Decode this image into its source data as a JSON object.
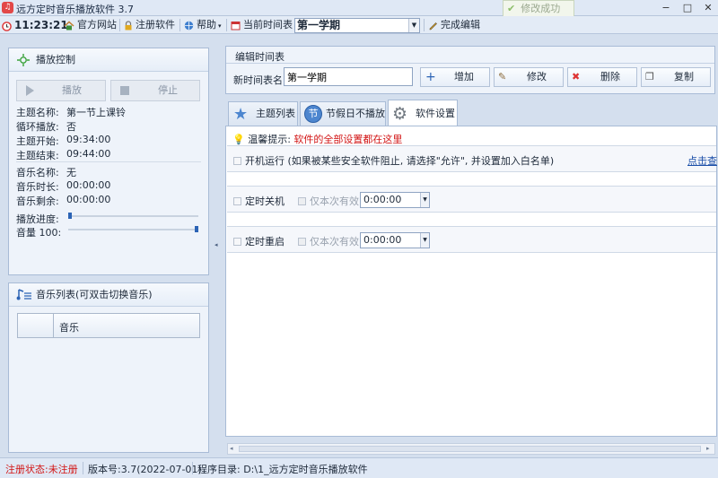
{
  "title": {
    "text": "远方定时音乐播放软件 3.7",
    "icon": "music-note-icon"
  },
  "window_controls": {
    "minimize": "−",
    "maximize": "□",
    "close": "✕"
  },
  "toast": {
    "text": "修改成功",
    "icon": "check-icon"
  },
  "toolbar": {
    "clock": "11:23:21",
    "official_site": "官方网站",
    "register": "注册软件",
    "help": "帮助",
    "current_timetable_label": "当前时间表",
    "current_timetable_value": "第一学期",
    "finish_edit": "完成编辑"
  },
  "playback": {
    "title": "播放控制",
    "play_button": "播放",
    "stop_button": "停止",
    "rows": [
      {
        "label": "主题名称:",
        "value": "第一节上课铃"
      },
      {
        "label": "循环播放:",
        "value": "否"
      },
      {
        "label": "主题开始:",
        "value": "09:34:00"
      },
      {
        "label": "主题结束:",
        "value": "09:44:00"
      },
      {
        "label": "音乐名称:",
        "value": "无"
      },
      {
        "label": "音乐时长:",
        "value": "00:00:00"
      },
      {
        "label": "音乐剩余:",
        "value": "00:00:00"
      }
    ],
    "progress_label": "播放进度:",
    "progress": 0.0,
    "volume_label": "音量 100:",
    "volume": 100
  },
  "music_list": {
    "title": "音乐列表(可双击切换音乐)",
    "column_header": "音乐"
  },
  "editor": {
    "group_title": "编辑时间表",
    "new_name_label": "新时间表名",
    "new_name_value": "第一学期",
    "add_button": "增加",
    "edit_button": "修改",
    "delete_button": "删除",
    "copy_button": "复制"
  },
  "tabs": [
    {
      "label": "主题列表",
      "icon": "star-icon"
    },
    {
      "label": "节假日不播放",
      "icon": "holiday-badge-icon",
      "badge": "节"
    },
    {
      "label": "软件设置",
      "icon": "gear-icon",
      "active": true
    }
  ],
  "settings": {
    "tip_label": "温馨提示:",
    "tip_text": "软件的全部设置都在这里",
    "autostart_label": "开机运行 (如果被某些安全软件阻止, 请选择\"允许\", 并设置加入白名单)",
    "autostart_link": "点击查",
    "shutdown_label": "定时关机",
    "shutdown_once_label": "仅本次有效",
    "shutdown_time": "0:00:00",
    "restart_label": "定时重启",
    "restart_once_label": "仅本次有效",
    "restart_time": "0:00:00"
  },
  "statusbar": {
    "reg_status": "注册状态:未注册",
    "version": "版本号:3.7(2022-07-01)",
    "program_dir": "程序目录: D:\\1_远方定时音乐播放软件"
  },
  "colors": {
    "accent": "#2b63b5",
    "warning_text": "#d21414",
    "link": "#1a4ea8",
    "panel_bg": "#eef3fa"
  }
}
